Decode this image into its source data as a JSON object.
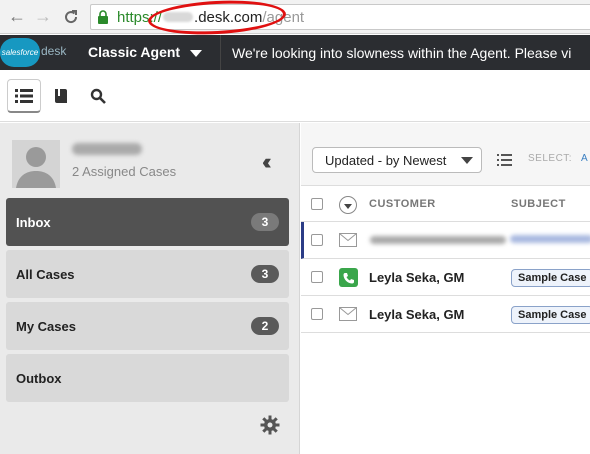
{
  "browser": {
    "url_scheme": "https://",
    "url_host": ".desk.com",
    "url_path": "/agent"
  },
  "header": {
    "logo_cloud_text": "salesforce",
    "logo_text": "desk",
    "agent_mode": "Classic Agent",
    "banner": "We're looking into slowness within the Agent. Please vi"
  },
  "sidebar": {
    "assigned_cases": "2 Assigned Cases",
    "filters": [
      {
        "label": "Inbox",
        "count": "3",
        "active": true
      },
      {
        "label": "All Cases",
        "count": "3"
      },
      {
        "label": "My Cases",
        "count": "2"
      },
      {
        "label": "Outbox",
        "count": ""
      }
    ]
  },
  "main": {
    "sort_label": "Updated - by Newest",
    "select_label": "SELECT:",
    "select_all_link": "A",
    "columns": {
      "customer": "CUSTOMER",
      "subject": "SUBJECT"
    },
    "rows": [
      {
        "type": "email",
        "customer": "",
        "subject": "",
        "redacted": true
      },
      {
        "type": "phone",
        "customer": "Leyla Seka, GM",
        "subject": "Sample Case"
      },
      {
        "type": "email",
        "customer": "Leyla Seka, GM",
        "subject": "Sample Case"
      }
    ]
  },
  "colors": {
    "header_bg": "#2b2d31",
    "sidebar_active": "#525252",
    "accent_green": "#3aa64b",
    "url_green": "#2b8a2b",
    "annotation_red": "#e01010"
  }
}
